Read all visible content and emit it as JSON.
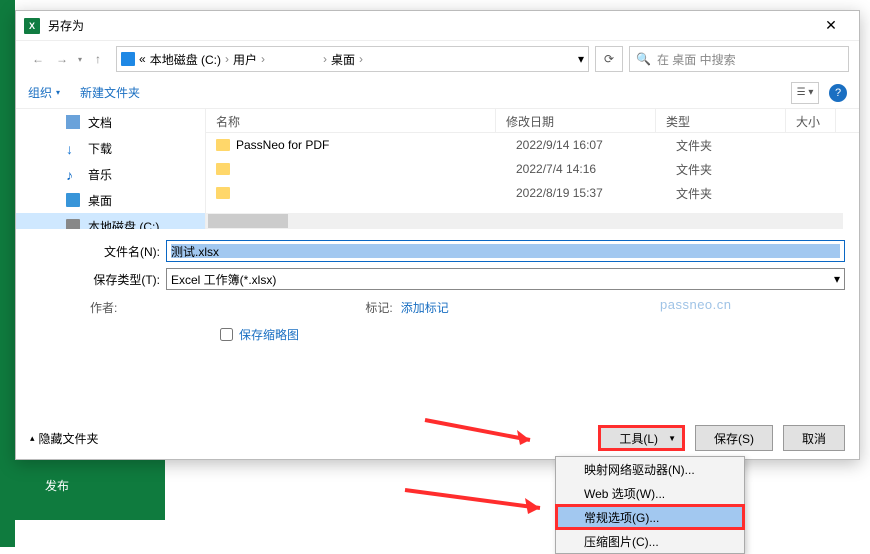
{
  "dialog": {
    "title": "另存为"
  },
  "nav": {
    "publish": "发布"
  },
  "breadcrumb": {
    "drive": "本地磁盘 (C:)",
    "users": "用户",
    "userblur": " ",
    "desktop": "桌面"
  },
  "search": {
    "placeholder": "在 桌面 中搜索"
  },
  "toolbar": {
    "organize": "组织",
    "newfolder": "新建文件夹"
  },
  "sidebar": {
    "items": [
      {
        "label": "文档"
      },
      {
        "label": "下载"
      },
      {
        "label": "音乐"
      },
      {
        "label": "桌面"
      },
      {
        "label": "本地磁盘 (C:)"
      }
    ]
  },
  "columns": {
    "name": "名称",
    "date": "修改日期",
    "type": "类型",
    "size": "大小"
  },
  "files": [
    {
      "name": "PassNeo for PDF",
      "date": "2022/9/14 16:07",
      "type": "文件夹"
    },
    {
      "name": " ",
      "date": "2022/7/4 14:16",
      "type": "文件夹"
    },
    {
      "name": " ",
      "date": "2022/8/19 15:37",
      "type": "文件夹"
    }
  ],
  "form": {
    "filename_label": "文件名(N):",
    "filename_value": "测试.xlsx",
    "filetype_label": "保存类型(T):",
    "filetype_value": "Excel 工作簿(*.xlsx)",
    "author_label": "作者:",
    "tags_label": "标记:",
    "addtag": "添加标记",
    "thumbnail": "保存缩略图"
  },
  "footer": {
    "hide": "隐藏文件夹",
    "tools": "工具(L)",
    "save": "保存(S)",
    "cancel": "取消"
  },
  "menu": {
    "map": "映射网络驱动器(N)...",
    "web": "Web 选项(W)...",
    "general": "常规选项(G)...",
    "compress": "压缩图片(C)..."
  },
  "watermark": "passneo.cn"
}
